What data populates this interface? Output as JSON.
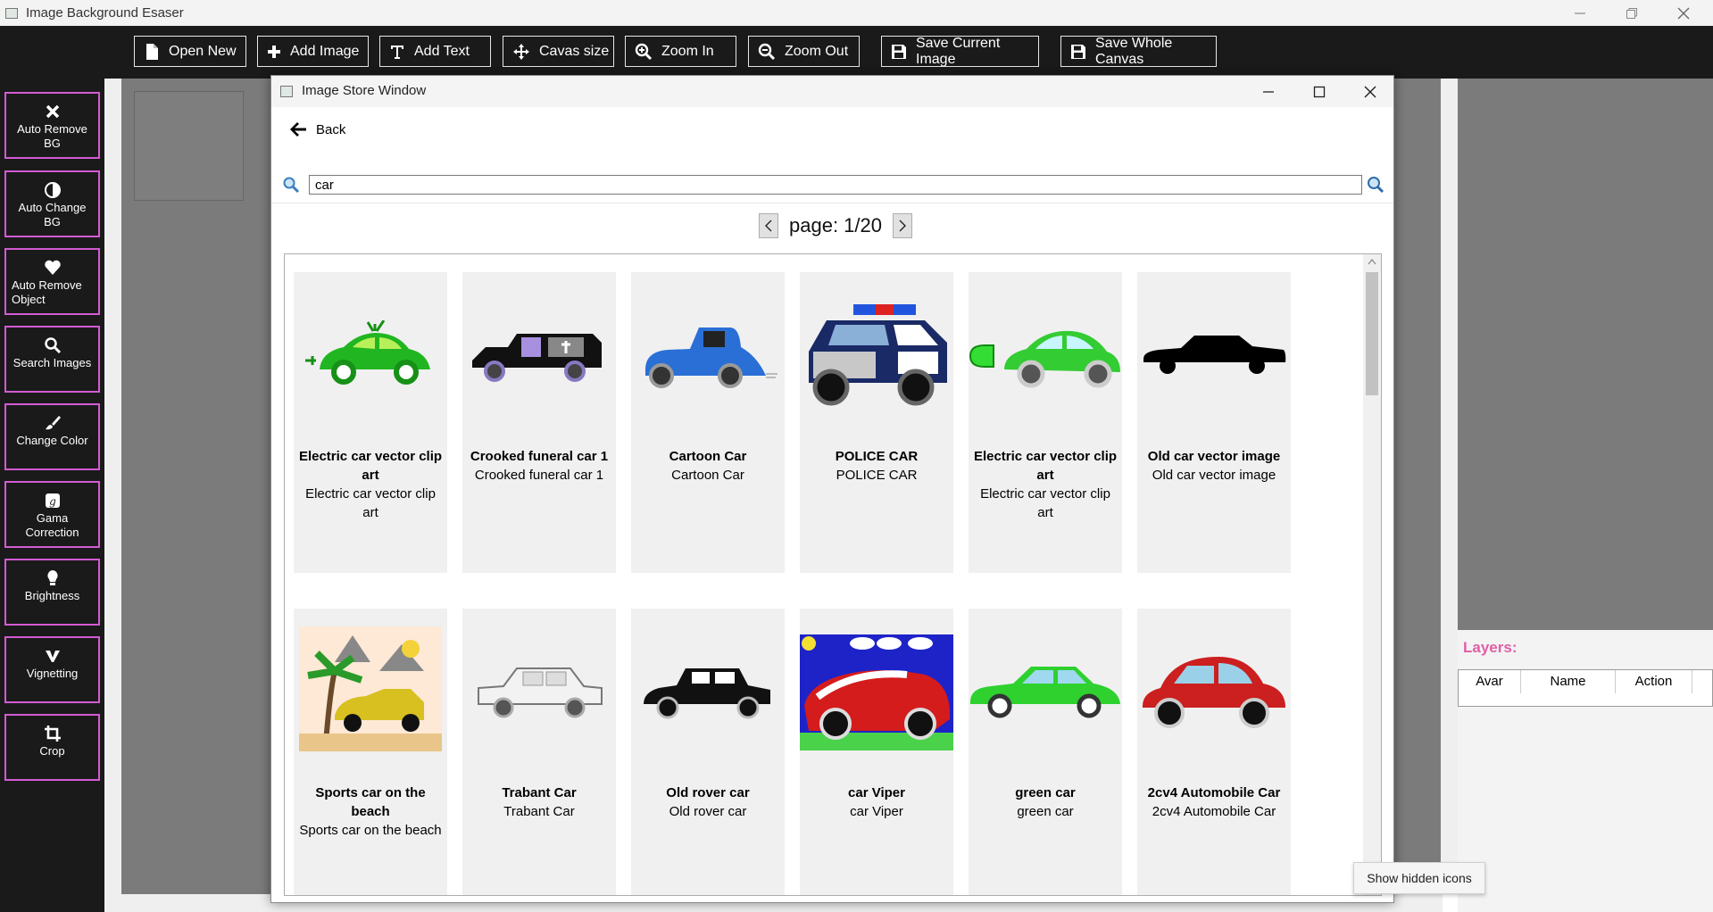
{
  "window": {
    "title": "Image Background Esaser"
  },
  "toolbar": {
    "open_new": "Open New",
    "add_image": "Add Image",
    "add_text": "Add Text",
    "canvas_size": "Cavas size",
    "zoom_in": "Zoom In",
    "zoom_out": "Zoom Out",
    "save_current": "Save Current Image",
    "save_whole": "Save Whole Canvas"
  },
  "sidebar": {
    "items": [
      {
        "label": "Auto Remove BG",
        "icon": "close-x-icon"
      },
      {
        "label": "Auto Change BG",
        "icon": "contrast-icon"
      },
      {
        "label": "Auto Remove Object",
        "icon": "heart-icon"
      },
      {
        "label": "Search Images",
        "icon": "search-icon"
      },
      {
        "label": "Change Color",
        "icon": "brush-icon"
      },
      {
        "label": "Gama Correction",
        "icon": "gamma-icon"
      },
      {
        "label": "Brightness",
        "icon": "lightbulb-icon"
      },
      {
        "label": "Vignetting",
        "icon": "vignette-icon"
      },
      {
        "label": "Crop",
        "icon": "crop-icon"
      }
    ]
  },
  "layers": {
    "title": "Layers:",
    "columns": [
      "Avar",
      "Name",
      "Action"
    ]
  },
  "dialog": {
    "title": "Image Store Window",
    "back_label": "Back",
    "search_value": "car",
    "page_text": "page: 1/20"
  },
  "results": [
    {
      "title": "Electric car vector clip art",
      "subtitle": "Electric car vector clip art",
      "color": "#22b022"
    },
    {
      "title": "Crooked funeral car 1",
      "subtitle": "Crooked funeral car 1",
      "color": "#111111"
    },
    {
      "title": "Cartoon Car",
      "subtitle": "Cartoon Car",
      "color": "#2a6fd6"
    },
    {
      "title": "POLICE CAR",
      "subtitle": "POLICE CAR",
      "color": "#1a2a66"
    },
    {
      "title": "Electric car vector clip art",
      "subtitle": "Electric car vector clip art",
      "color": "#33cc33"
    },
    {
      "title": "Old car vector image",
      "subtitle": "Old car vector image",
      "color": "#000000"
    },
    {
      "title": "Sports car on the beach",
      "subtitle": "Sports car on the beach",
      "color": "#d8c020"
    },
    {
      "title": "Trabant Car",
      "subtitle": "Trabant Car",
      "color": "#e8e8e8"
    },
    {
      "title": "Old rover car",
      "subtitle": "Old rover car",
      "color": "#111111"
    },
    {
      "title": "car Viper",
      "subtitle": "car Viper",
      "color": "#d41c1c"
    },
    {
      "title": "green car",
      "subtitle": "green car",
      "color": "#2ed12e"
    },
    {
      "title": "2cv4 Automobile Car",
      "subtitle": "2cv4 Automobile Car",
      "color": "#cc1f1f"
    }
  ],
  "tooltip": "Show hidden icons",
  "colors": {
    "toolbar_bg": "#1a1a1a",
    "sidebar_border": "#d35bd3",
    "layers_title": "#e05fa6",
    "canvas_bg": "#7b7b7b"
  }
}
